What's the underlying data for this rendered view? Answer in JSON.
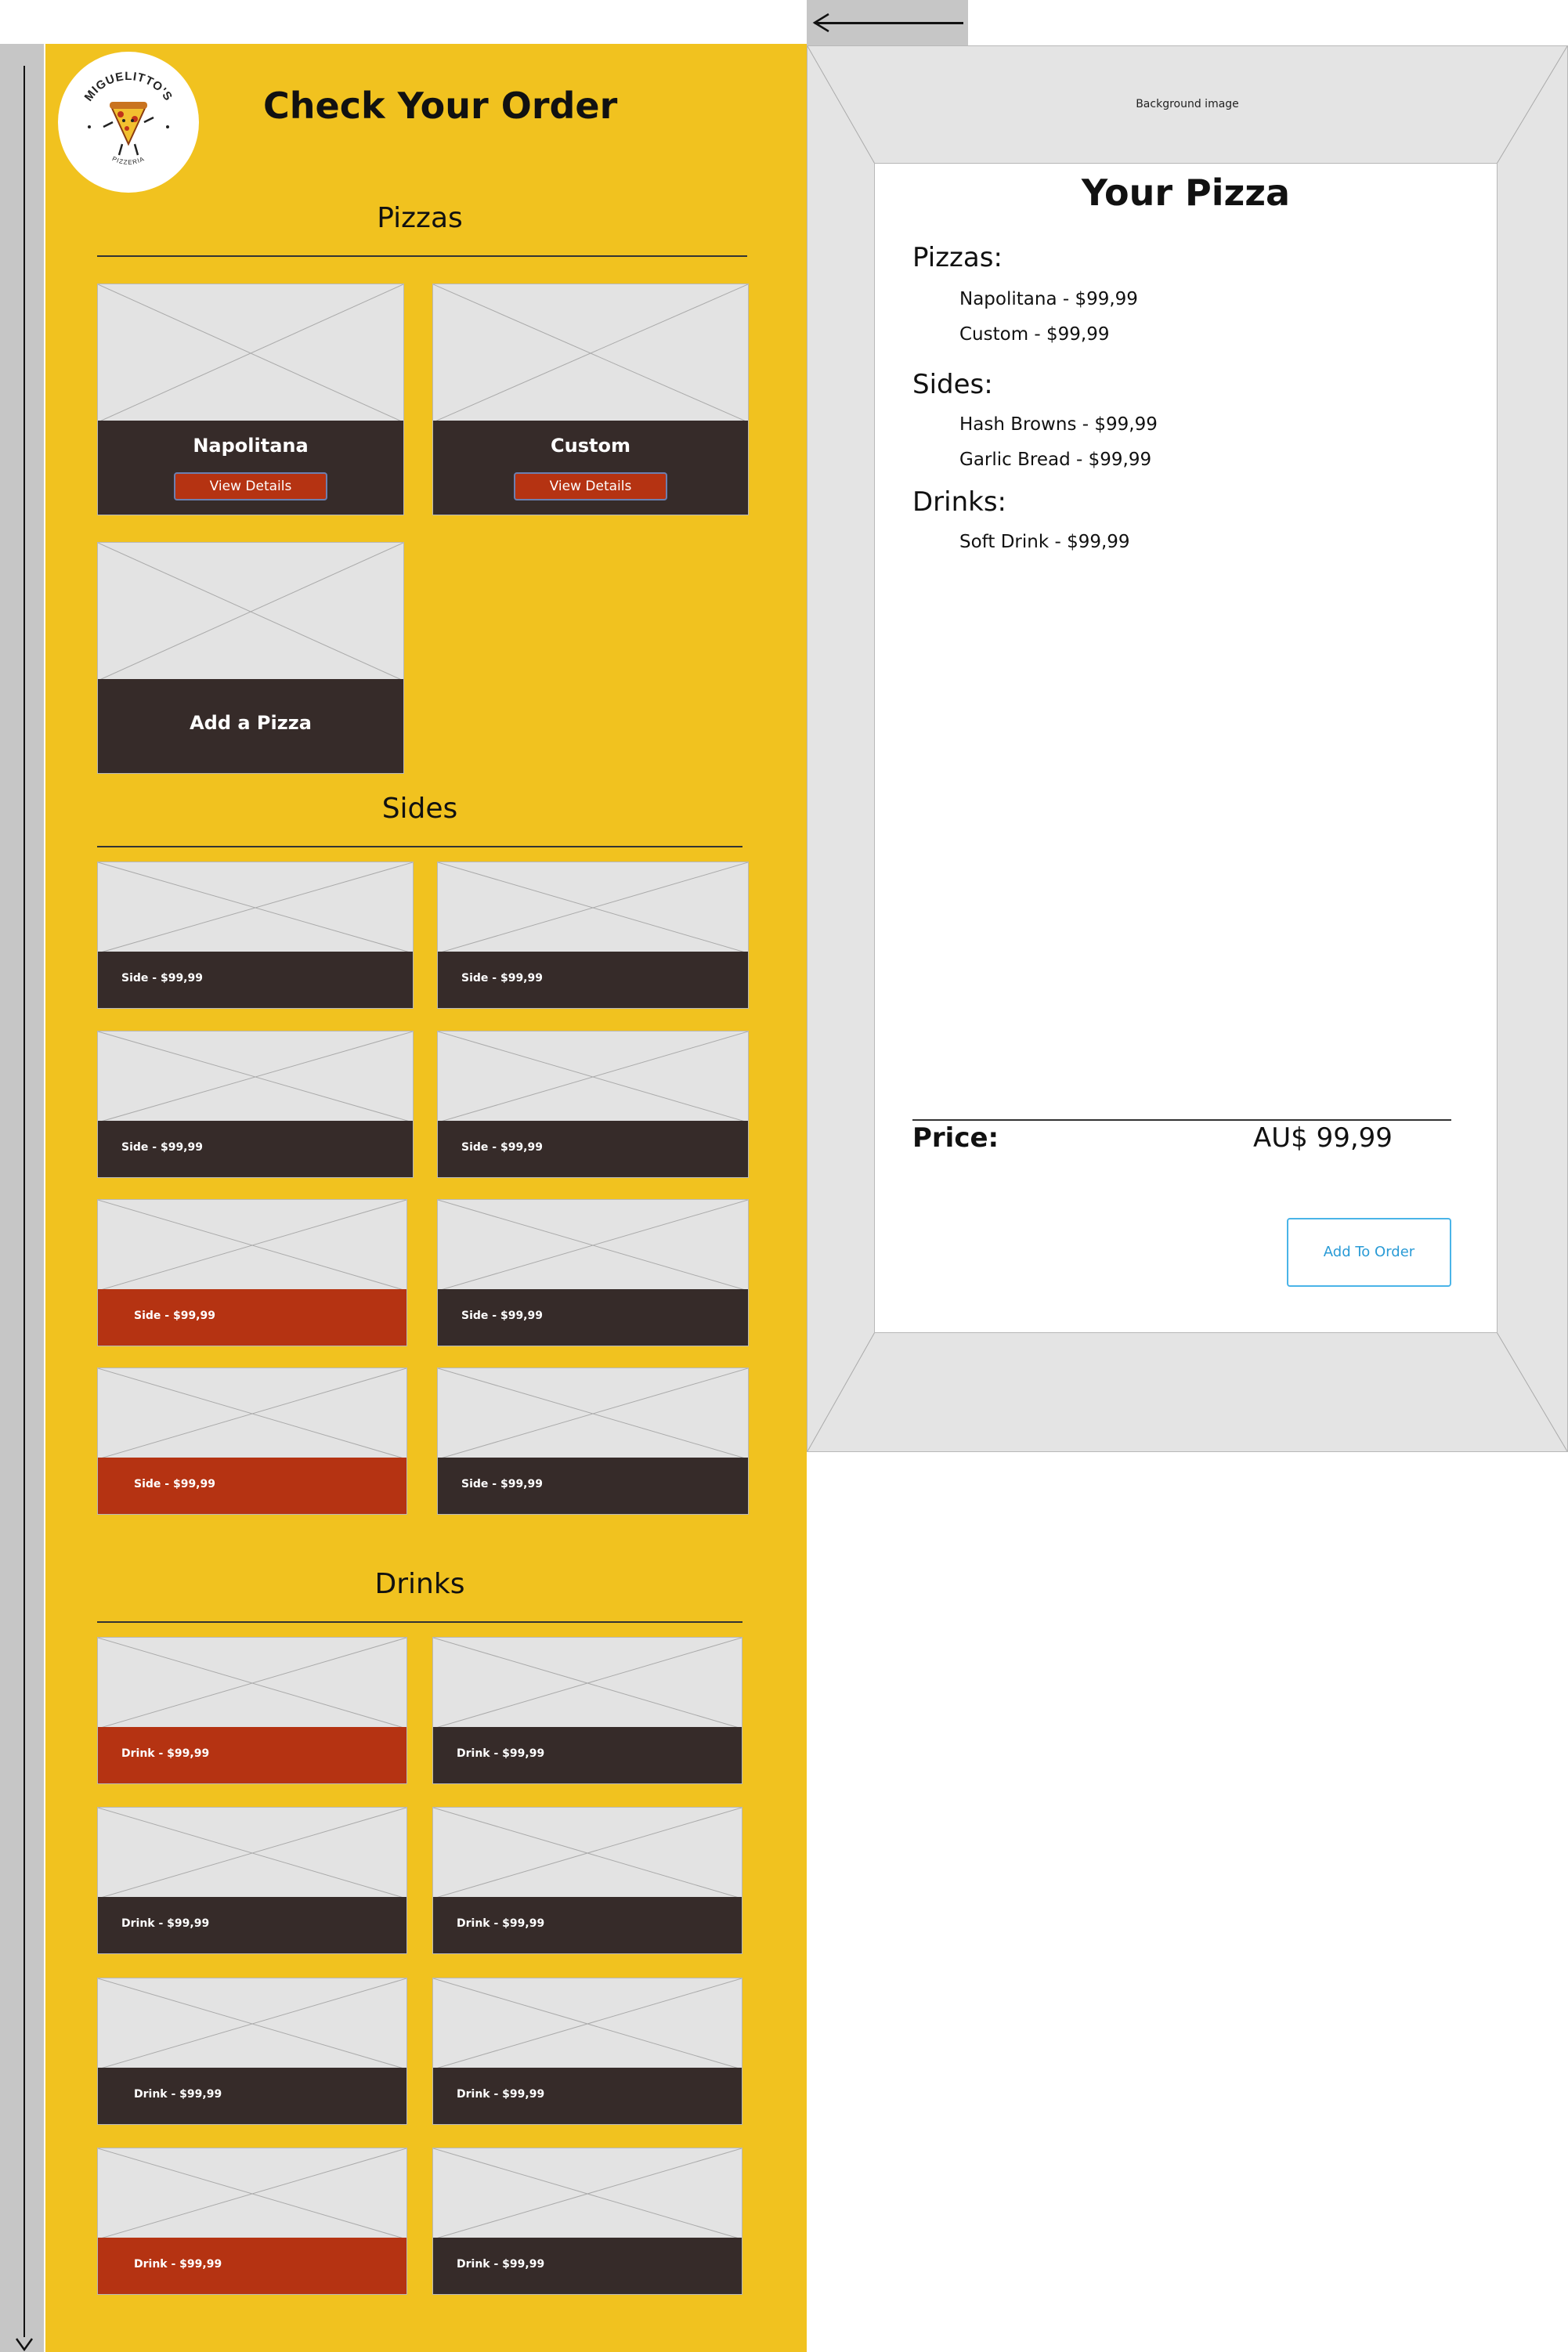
{
  "page": {
    "title": "Check Your Order",
    "logo": {
      "text": "MIGUELITTO'S",
      "sub": "PIZZERIA",
      "icon": "pizza-mascot-icon"
    }
  },
  "sections": {
    "pizzas": "Pizzas",
    "sides": "Sides",
    "drinks": "Drinks"
  },
  "pizzas": [
    {
      "name": "Napolitana",
      "button": "View Details"
    },
    {
      "name": "Custom",
      "button": "View Details"
    },
    {
      "name": "Add a Pizza"
    }
  ],
  "sides": [
    {
      "label": "Side - $99,99",
      "selected": false
    },
    {
      "label": "Side - $99,99",
      "selected": false
    },
    {
      "label": "Side - $99,99",
      "selected": false
    },
    {
      "label": "Side - $99,99",
      "selected": false
    },
    {
      "label": "Side - $99,99",
      "selected": true
    },
    {
      "label": "Side - $99,99",
      "selected": false
    },
    {
      "label": "Side - $99,99",
      "selected": true
    },
    {
      "label": "Side - $99,99",
      "selected": false
    }
  ],
  "drinks": [
    {
      "label": "Drink - $99,99",
      "selected": true
    },
    {
      "label": "Drink - $99,99",
      "selected": false
    },
    {
      "label": "Drink - $99,99",
      "selected": false
    },
    {
      "label": "Drink - $99,99",
      "selected": false
    },
    {
      "label": "Drink - $99,99",
      "selected": false
    },
    {
      "label": "Drink - $99,99",
      "selected": false
    },
    {
      "label": "Drink - $99,99",
      "selected": true
    },
    {
      "label": "Drink - $99,99",
      "selected": false
    }
  ],
  "right": {
    "background_label": "Background image",
    "back_icon": "arrow-left-icon"
  },
  "order": {
    "title": "Your Pizza",
    "groups": [
      {
        "heading": "Pizzas:",
        "items": [
          "Napolitana - $99,99",
          "Custom - $99,99"
        ]
      },
      {
        "heading": "Sides:",
        "items": [
          "Hash Browns - $99,99",
          "Garlic Bread - $99,99"
        ]
      },
      {
        "heading": "Drinks:",
        "items": [
          "Soft Drink - $99,99"
        ]
      }
    ],
    "price_label": "Price:",
    "price_value": "AU$ 99,99",
    "button": "Add To Order"
  },
  "colors": {
    "panel": "#f1c21f",
    "card_band": "#362b29",
    "accent": "#b53312",
    "button_outline": "#4ab4e8"
  }
}
